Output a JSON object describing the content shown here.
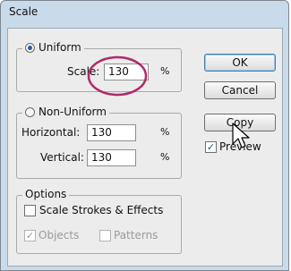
{
  "window": {
    "title": "Scale"
  },
  "uniform": {
    "label": "Uniform",
    "selected": true,
    "scale_label": "Scale:",
    "scale_value": "130",
    "unit": "%"
  },
  "non_uniform": {
    "label": "Non-Uniform",
    "selected": false,
    "horizontal_label": "Horizontal:",
    "horizontal_value": "130",
    "vertical_label": "Vertical:",
    "vertical_value": "130",
    "unit": "%"
  },
  "options": {
    "label": "Options",
    "scale_strokes_label": "Scale Strokes & Effects",
    "scale_strokes_checked": false,
    "objects_label": "Objects",
    "objects_checked": true,
    "patterns_label": "Patterns",
    "patterns_checked": false
  },
  "buttons": {
    "ok": "OK",
    "cancel": "Cancel",
    "copy": "Copy"
  },
  "preview": {
    "label": "Preview",
    "checked": true
  },
  "icons": {
    "checkmark": "✓"
  },
  "colors": {
    "highlight_circle": "#b02a6b",
    "accent": "#1e5fa8"
  }
}
